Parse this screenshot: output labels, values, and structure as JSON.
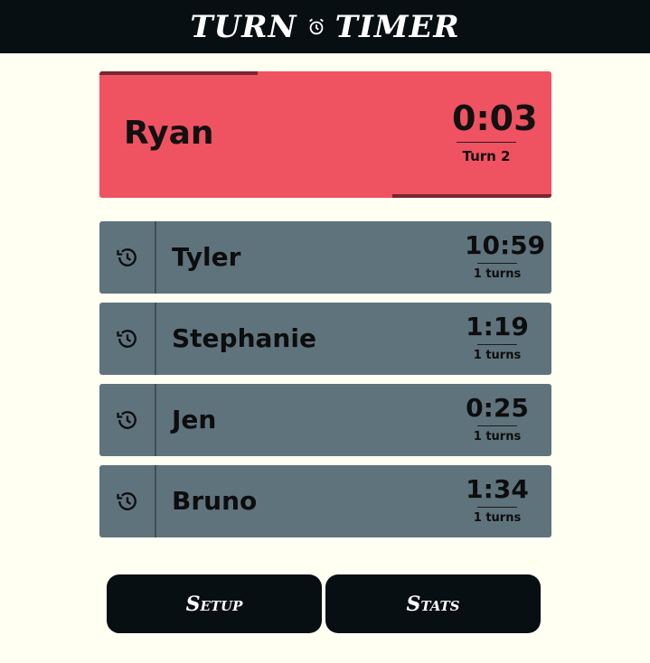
{
  "header": {
    "title_left": "TURN",
    "title_right": "TIMER",
    "clock_icon": "alarm-clock-icon"
  },
  "active_player": {
    "name": "Ryan",
    "time": "0:03",
    "turn_label": "Turn 2",
    "color": "#ef5261"
  },
  "players": [
    {
      "name": "Tyler",
      "time": "10:59",
      "turns": "1 turns",
      "icon": "history-icon"
    },
    {
      "name": "Stephanie",
      "time": "1:19",
      "turns": "1 turns",
      "icon": "history-icon"
    },
    {
      "name": "Jen",
      "time": "0:25",
      "turns": "1 turns",
      "icon": "history-icon"
    },
    {
      "name": "Bruno",
      "time": "1:34",
      "turns": "1 turns",
      "icon": "history-icon"
    }
  ],
  "buttons": {
    "setup_label": "Setup",
    "stats_label": "Stats"
  },
  "colors": {
    "background": "#fffff2",
    "topbar": "#070f13",
    "row": "#5f737d"
  }
}
